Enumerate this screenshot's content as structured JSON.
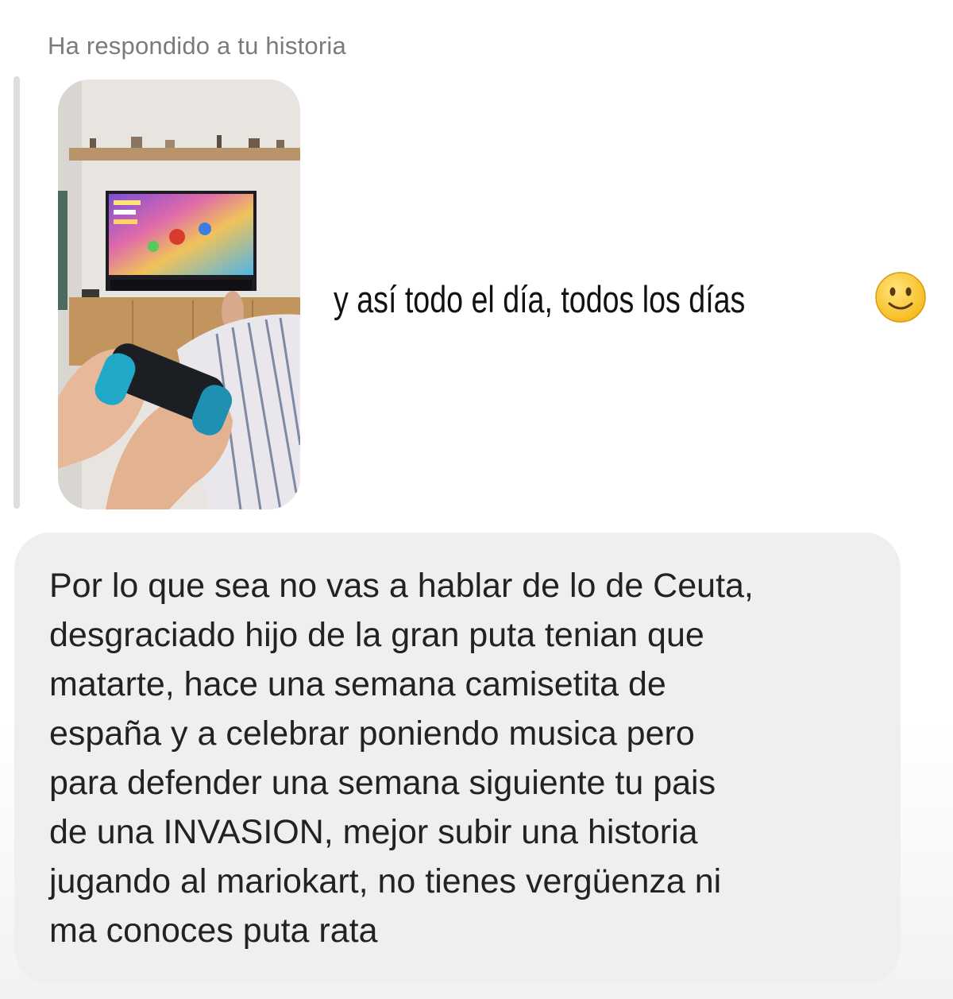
{
  "header": {
    "reply_label": "Ha respondido a tu historia"
  },
  "story": {
    "caption": "y así todo el día, todos los días",
    "emoji": "slightly-smiling-face-icon"
  },
  "message": {
    "lines": [
      "Por lo que sea no vas a hablar de lo de Ceuta,",
      "desgraciado hijo de la gran puta tenian que",
      "matarte, hace una semana camisetita de",
      "españa y a celebrar poniendo musica pero",
      "para defender una semana siguiente tu pais",
      "de una INVASION, mejor subir una historia",
      "jugando al mariokart, no tienes vergüenza ni",
      "ma conoces puta rata"
    ]
  },
  "colors": {
    "bubble_background": "#efeff1",
    "header_text": "#7b7b7b",
    "message_text": "#222222",
    "reply_bar": "#dedede"
  }
}
